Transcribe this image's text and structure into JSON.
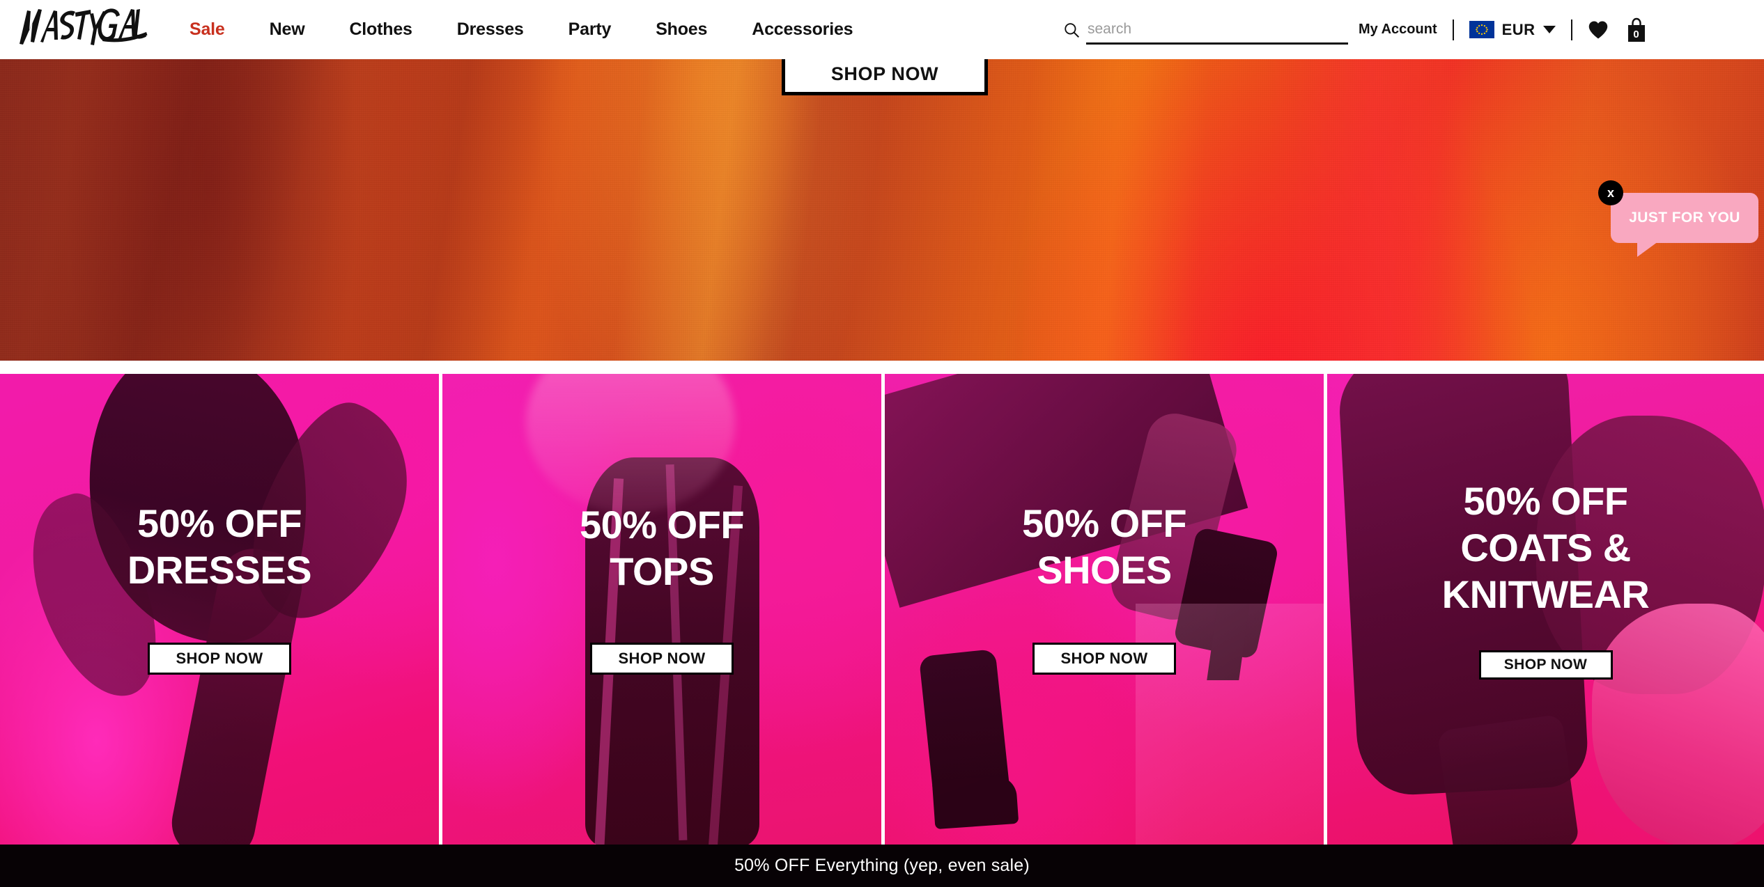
{
  "header": {
    "logo_text": "NASTY GAL",
    "logo_icon": "nasty-gal-wordmark",
    "nav": [
      {
        "label": "Sale",
        "accent": true
      },
      {
        "label": "New",
        "accent": false
      },
      {
        "label": "Clothes",
        "accent": false
      },
      {
        "label": "Dresses",
        "accent": false
      },
      {
        "label": "Party",
        "accent": false
      },
      {
        "label": "Shoes",
        "accent": false
      },
      {
        "label": "Accessories",
        "accent": false
      }
    ],
    "search": {
      "icon": "search-icon",
      "placeholder": "search",
      "value": ""
    },
    "my_account_label": "My Account",
    "currency": {
      "flag_icon": "eu-flag-icon",
      "code": "EUR",
      "caret_icon": "chevron-down-icon"
    },
    "wishlist_icon": "heart-icon",
    "bag": {
      "icon": "shopping-bag-icon",
      "count": "0"
    }
  },
  "hero": {
    "shop_now_label": "SHOP NOW",
    "just_for_you": {
      "label": "JUST FOR YOU",
      "close_label": "x",
      "close_icon": "close-icon",
      "bubble_color": "#F9A8C0"
    }
  },
  "tiles": [
    {
      "heading_line1": "50% OFF",
      "heading_line2": "DRESSES",
      "cta_label": "SHOP NOW"
    },
    {
      "heading_line1": "50% OFF",
      "heading_line2": "TOPS",
      "cta_label": "SHOP NOW"
    },
    {
      "heading_line1": "50% OFF",
      "heading_line2": "SHOES",
      "cta_label": "SHOP NOW"
    },
    {
      "heading_line1": "50% OFF",
      "heading_line2": "COATS &",
      "heading_line3": "KNITWEAR",
      "cta_label": "SHOP NOW"
    }
  ],
  "promo_bar": {
    "text": "50% OFF Everything (yep, even sale)"
  },
  "colors": {
    "sale_accent": "#c8301e",
    "bubble_pink": "#F9A8C0",
    "tile_magenta": "#E8129A",
    "promo_bar_bg": "#070205",
    "eu_flag_blue": "#003399"
  }
}
